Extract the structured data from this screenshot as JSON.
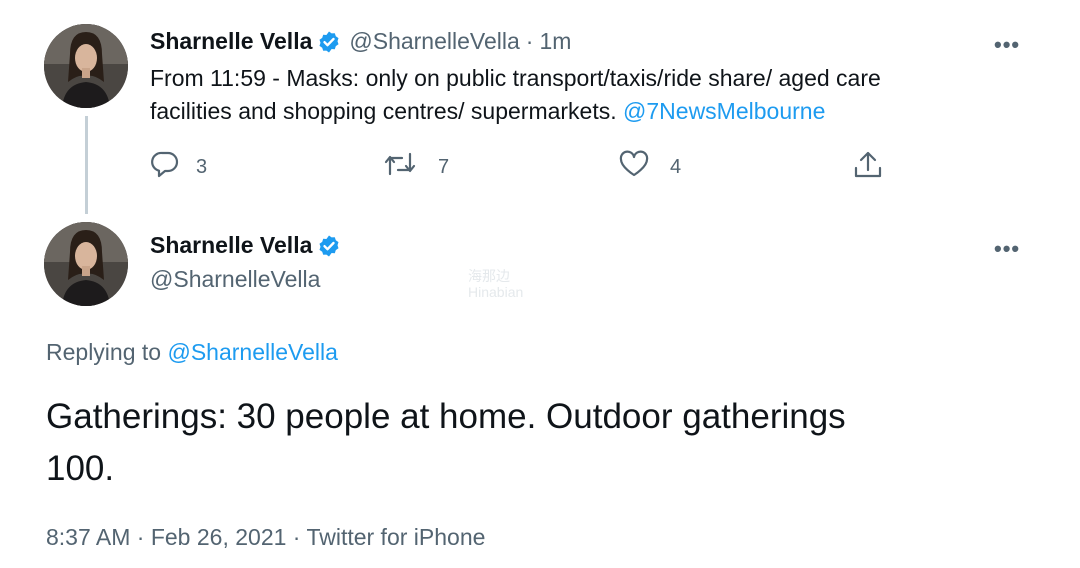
{
  "tweet1": {
    "author_name": "Sharnelle Vella",
    "author_handle": "@SharnelleVella",
    "separator": "·",
    "time": "1m",
    "text_line1": "From 11:59 - Masks: only on public transport/taxis/ride share/ aged care",
    "text_line2": "facilities and shopping centres/ supermarkets. ",
    "mention": "@7NewsMelbourne",
    "more_label": "•••",
    "actions": {
      "reply_count": "3",
      "retweet_count": "7",
      "like_count": "4"
    }
  },
  "tweet2": {
    "author_name": "Sharnelle Vella",
    "author_handle": "@SharnelleVella",
    "more_label": "•••",
    "replying_prefix": "Replying to ",
    "replying_handle": "@SharnelleVella",
    "text_line1": "Gatherings: 30 people at home. Outdoor gatherings",
    "text_line2": "100.",
    "timestamp_time": "8:37 AM",
    "separator1": " · ",
    "timestamp_date": "Feb 26, 2021",
    "separator2": " · ",
    "source": "Twitter for iPhone"
  },
  "watermark": {
    "line1": "海那边",
    "line2": "Hinabian"
  },
  "colors": {
    "accent": "#1d9bf0",
    "secondary_text": "#536471",
    "primary_text": "#0f1419",
    "thread_line": "#c4cfd6"
  },
  "icons": {
    "verified": "verified-badge-icon",
    "reply": "reply-icon",
    "retweet": "retweet-icon",
    "like": "like-icon",
    "share": "share-icon",
    "more": "more-icon"
  }
}
